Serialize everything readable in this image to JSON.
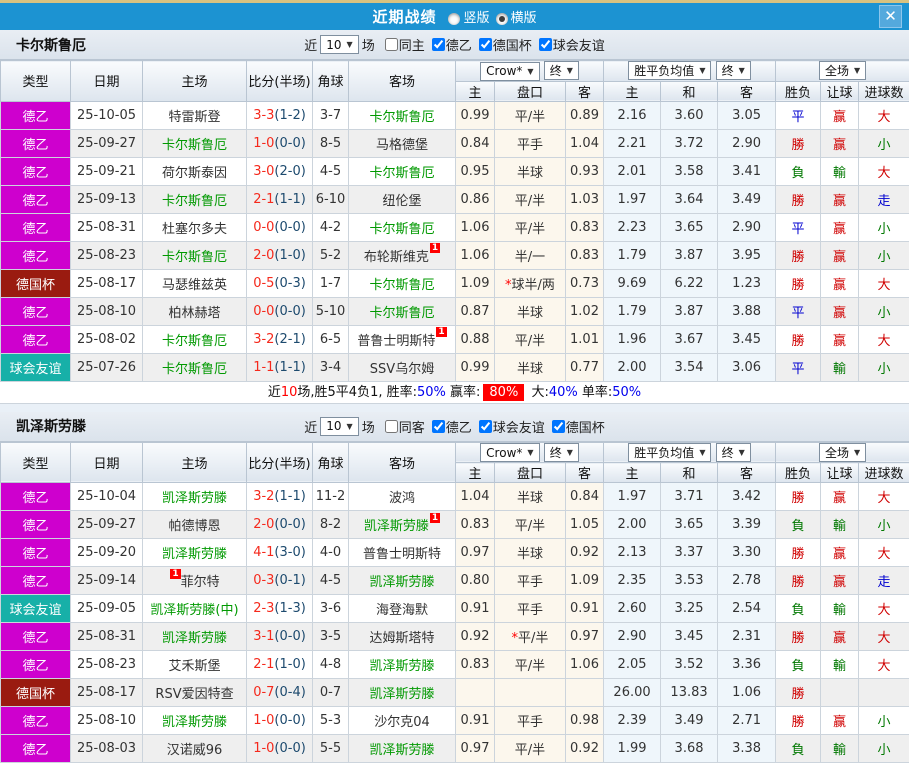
{
  "titlebar": {
    "title": "近期战绩",
    "radios": [
      {
        "label": "竖版",
        "selected": false
      },
      {
        "label": "横版",
        "selected": true
      }
    ],
    "close": "✕"
  },
  "table_header": {
    "main": [
      "类型",
      "日期",
      "主场",
      "比分(半场)",
      "角球",
      "客场"
    ],
    "groups": {
      "odds": [
        "Crow*",
        "终"
      ],
      "mean": [
        "胜平负均值",
        "终"
      ],
      "full": [
        "全场"
      ]
    },
    "sub": [
      "主",
      "盘口",
      "客",
      "主",
      "和",
      "客",
      "胜负",
      "让球",
      "进球数"
    ]
  },
  "type_colors": {
    "德乙": "#ce00ce",
    "德国杯": "#9a1b10",
    "球会友谊": "#17b0a8"
  },
  "colors": {
    "titlebar_blue": "#1c93d2",
    "team_green": "#009900",
    "score_red": "#f5291c",
    "result_red": "#d00000",
    "result_blue": "#0000d0",
    "result_green": "#007800"
  },
  "tables": [
    {
      "team": "卡尔斯鲁厄",
      "filters": {
        "near": "近",
        "count": "10",
        "unit": "场",
        "checkboxes": [
          {
            "label": "同主",
            "checked": false
          },
          {
            "label": "德乙",
            "checked": true
          },
          {
            "label": "德国杯",
            "checked": true
          },
          {
            "label": "球会友谊",
            "checked": true
          }
        ]
      },
      "rows": [
        {
          "type": "德乙",
          "date": "25-10-05",
          "home": {
            "name": "特雷斯登"
          },
          "score": {
            "full": "3-3",
            "half": "(1-2)"
          },
          "corner": "3-7",
          "away": {
            "name": "卡尔斯鲁厄",
            "green": true
          },
          "odds": {
            "home": "0.99",
            "handicap": "平/半",
            "away": "0.89"
          },
          "mean": {
            "home": "2.16",
            "draw": "3.60",
            "away": "3.05"
          },
          "results": [
            "平",
            "赢",
            "大"
          ]
        },
        {
          "type": "德乙",
          "date": "25-09-27",
          "home": {
            "name": "卡尔斯鲁厄",
            "green": true
          },
          "score": {
            "full": "1-0",
            "half": "(0-0)"
          },
          "corner": "8-5",
          "away": {
            "name": "马格德堡"
          },
          "odds": {
            "home": "0.84",
            "handicap": "平手",
            "away": "1.04"
          },
          "mean": {
            "home": "2.21",
            "draw": "3.72",
            "away": "2.90"
          },
          "results": [
            "勝",
            "赢",
            "小"
          ]
        },
        {
          "type": "德乙",
          "date": "25-09-21",
          "home": {
            "name": "荷尔斯泰因"
          },
          "score": {
            "full": "3-0",
            "half": "(2-0)"
          },
          "corner": "4-5",
          "away": {
            "name": "卡尔斯鲁厄",
            "green": true
          },
          "odds": {
            "home": "0.95",
            "handicap": "半球",
            "away": "0.93"
          },
          "mean": {
            "home": "2.01",
            "draw": "3.58",
            "away": "3.41"
          },
          "results": [
            "負",
            "輸",
            "大"
          ]
        },
        {
          "type": "德乙",
          "date": "25-09-13",
          "home": {
            "name": "卡尔斯鲁厄",
            "green": true
          },
          "score": {
            "full": "2-1",
            "half": "(1-1)"
          },
          "corner": "6-10",
          "away": {
            "name": "纽伦堡"
          },
          "odds": {
            "home": "0.86",
            "handicap": "平/半",
            "away": "1.03"
          },
          "mean": {
            "home": "1.97",
            "draw": "3.64",
            "away": "3.49"
          },
          "results": [
            "勝",
            "赢",
            "走"
          ]
        },
        {
          "type": "德乙",
          "date": "25-08-31",
          "home": {
            "name": "杜塞尔多夫"
          },
          "score": {
            "full": "0-0",
            "half": "(0-0)"
          },
          "corner": "4-2",
          "away": {
            "name": "卡尔斯鲁厄",
            "green": true
          },
          "odds": {
            "home": "1.06",
            "handicap": "平/半",
            "away": "0.83"
          },
          "mean": {
            "home": "2.23",
            "draw": "3.65",
            "away": "2.90"
          },
          "results": [
            "平",
            "赢",
            "小"
          ]
        },
        {
          "type": "德乙",
          "date": "25-08-23",
          "home": {
            "name": "卡尔斯鲁厄",
            "green": true
          },
          "score": {
            "full": "2-0",
            "half": "(1-0)"
          },
          "corner": "5-2",
          "away": {
            "name": "布轮斯维克",
            "card": "after"
          },
          "odds": {
            "home": "1.06",
            "handicap": "半/一",
            "away": "0.83"
          },
          "mean": {
            "home": "1.79",
            "draw": "3.87",
            "away": "3.95"
          },
          "results": [
            "勝",
            "赢",
            "小"
          ]
        },
        {
          "type": "德国杯",
          "date": "25-08-17",
          "home": {
            "name": "马瑟维兹英"
          },
          "score": {
            "full": "0-5",
            "half": "(0-3)"
          },
          "corner": "1-7",
          "away": {
            "name": "卡尔斯鲁厄",
            "green": true
          },
          "odds": {
            "home": "1.09",
            "handicap": "球半/两",
            "star": true,
            "away": "0.73"
          },
          "mean": {
            "home": "9.69",
            "draw": "6.22",
            "away": "1.23"
          },
          "results": [
            "勝",
            "赢",
            "大"
          ]
        },
        {
          "type": "德乙",
          "date": "25-08-10",
          "home": {
            "name": "柏林赫塔"
          },
          "score": {
            "full": "0-0",
            "half": "(0-0)"
          },
          "corner": "5-10",
          "away": {
            "name": "卡尔斯鲁厄",
            "green": true
          },
          "odds": {
            "home": "0.87",
            "handicap": "半球",
            "away": "1.02"
          },
          "mean": {
            "home": "1.79",
            "draw": "3.87",
            "away": "3.88"
          },
          "results": [
            "平",
            "赢",
            "小"
          ]
        },
        {
          "type": "德乙",
          "date": "25-08-02",
          "home": {
            "name": "卡尔斯鲁厄",
            "green": true
          },
          "score": {
            "full": "3-2",
            "half": "(2-1)"
          },
          "corner": "6-5",
          "away": {
            "name": "普鲁士明斯特",
            "card": "after"
          },
          "odds": {
            "home": "0.88",
            "handicap": "平/半",
            "away": "1.01"
          },
          "mean": {
            "home": "1.96",
            "draw": "3.67",
            "away": "3.45"
          },
          "results": [
            "勝",
            "赢",
            "大"
          ]
        },
        {
          "type": "球会友谊",
          "date": "25-07-26",
          "home": {
            "name": "卡尔斯鲁厄",
            "green": true
          },
          "score": {
            "full": "1-1",
            "half": "(1-1)"
          },
          "corner": "3-4",
          "away": {
            "name": "SSV乌尔姆"
          },
          "odds": {
            "home": "0.99",
            "handicap": "半球",
            "away": "0.77"
          },
          "mean": {
            "home": "2.00",
            "draw": "3.54",
            "away": "3.06"
          },
          "results": [
            "平",
            "輸",
            "小"
          ]
        }
      ],
      "summary": [
        {
          "t": "近"
        },
        {
          "t": "10",
          "c": "red"
        },
        {
          "t": "场,胜5平4负1, 胜率:"
        },
        {
          "t": "50%",
          "c": "blue"
        },
        {
          "t": " 赢率:"
        },
        {
          "t": "80%",
          "c": "redbox"
        },
        {
          "t": " 大:"
        },
        {
          "t": "40%",
          "c": "blue"
        },
        {
          "t": " 单率:"
        },
        {
          "t": "50%",
          "c": "blue"
        }
      ]
    },
    {
      "team": "凯泽斯劳滕",
      "filters": {
        "near": "近",
        "count": "10",
        "unit": "场",
        "checkboxes": [
          {
            "label": "同客",
            "checked": false
          },
          {
            "label": "德乙",
            "checked": true
          },
          {
            "label": "球会友谊",
            "checked": true
          },
          {
            "label": "德国杯",
            "checked": true
          }
        ]
      },
      "rows": [
        {
          "type": "德乙",
          "date": "25-10-04",
          "home": {
            "name": "凯泽斯劳滕",
            "green": true
          },
          "score": {
            "full": "3-2",
            "half": "(1-1)"
          },
          "corner": "11-2",
          "away": {
            "name": "波鸿"
          },
          "odds": {
            "home": "1.04",
            "handicap": "半球",
            "away": "0.84"
          },
          "mean": {
            "home": "1.97",
            "draw": "3.71",
            "away": "3.42"
          },
          "results": [
            "勝",
            "赢",
            "大"
          ]
        },
        {
          "type": "德乙",
          "date": "25-09-27",
          "home": {
            "name": "帕德博恩"
          },
          "score": {
            "full": "2-0",
            "half": "(0-0)"
          },
          "corner": "8-2",
          "away": {
            "name": "凯泽斯劳滕",
            "green": true,
            "card": "after"
          },
          "odds": {
            "home": "0.83",
            "handicap": "平/半",
            "away": "1.05"
          },
          "mean": {
            "home": "2.00",
            "draw": "3.65",
            "away": "3.39"
          },
          "results": [
            "負",
            "輸",
            "小"
          ]
        },
        {
          "type": "德乙",
          "date": "25-09-20",
          "home": {
            "name": "凯泽斯劳滕",
            "green": true
          },
          "score": {
            "full": "4-1",
            "half": "(3-0)"
          },
          "corner": "4-0",
          "away": {
            "name": "普鲁士明斯特"
          },
          "odds": {
            "home": "0.97",
            "handicap": "半球",
            "away": "0.92"
          },
          "mean": {
            "home": "2.13",
            "draw": "3.37",
            "away": "3.30"
          },
          "results": [
            "勝",
            "赢",
            "大"
          ]
        },
        {
          "type": "德乙",
          "date": "25-09-14",
          "home": {
            "name": "菲尔特",
            "card": "before"
          },
          "score": {
            "full": "0-3",
            "half": "(0-1)"
          },
          "corner": "4-5",
          "away": {
            "name": "凯泽斯劳滕",
            "green": true
          },
          "odds": {
            "home": "0.80",
            "handicap": "平手",
            "away": "1.09"
          },
          "mean": {
            "home": "2.35",
            "draw": "3.53",
            "away": "2.78"
          },
          "results": [
            "勝",
            "赢",
            "走"
          ]
        },
        {
          "type": "球会友谊",
          "date": "25-09-05",
          "home": {
            "name": "凯泽斯劳滕(中)",
            "green": true
          },
          "score": {
            "full": "2-3",
            "half": "(1-3)"
          },
          "corner": "3-6",
          "away": {
            "name": "海登海默"
          },
          "odds": {
            "home": "0.91",
            "handicap": "平手",
            "away": "0.91"
          },
          "mean": {
            "home": "2.60",
            "draw": "3.25",
            "away": "2.54"
          },
          "results": [
            "負",
            "輸",
            "大"
          ]
        },
        {
          "type": "德乙",
          "date": "25-08-31",
          "home": {
            "name": "凯泽斯劳滕",
            "green": true
          },
          "score": {
            "full": "3-1",
            "half": "(0-0)"
          },
          "corner": "3-5",
          "away": {
            "name": "达姆斯塔特"
          },
          "odds": {
            "home": "0.92",
            "handicap": "平/半",
            "star": true,
            "away": "0.97"
          },
          "mean": {
            "home": "2.90",
            "draw": "3.45",
            "away": "2.31"
          },
          "results": [
            "勝",
            "赢",
            "大"
          ]
        },
        {
          "type": "德乙",
          "date": "25-08-23",
          "home": {
            "name": "艾禾斯堡"
          },
          "score": {
            "full": "2-1",
            "half": "(1-0)"
          },
          "corner": "4-8",
          "away": {
            "name": "凯泽斯劳滕",
            "green": true
          },
          "odds": {
            "home": "0.83",
            "handicap": "平/半",
            "away": "1.06"
          },
          "mean": {
            "home": "2.05",
            "draw": "3.52",
            "away": "3.36"
          },
          "results": [
            "負",
            "輸",
            "大"
          ]
        },
        {
          "type": "德国杯",
          "date": "25-08-17",
          "home": {
            "name": "RSV爱因特查"
          },
          "score": {
            "full": "0-7",
            "half": "(0-4)"
          },
          "corner": "0-7",
          "away": {
            "name": "凯泽斯劳滕",
            "green": true
          },
          "odds": {
            "home": "",
            "handicap": "",
            "away": ""
          },
          "mean": {
            "home": "26.00",
            "draw": "13.83",
            "away": "1.06"
          },
          "results": [
            "勝",
            "",
            ""
          ]
        },
        {
          "type": "德乙",
          "date": "25-08-10",
          "home": {
            "name": "凯泽斯劳滕",
            "green": true
          },
          "score": {
            "full": "1-0",
            "half": "(0-0)"
          },
          "corner": "5-3",
          "away": {
            "name": "沙尔克04"
          },
          "odds": {
            "home": "0.91",
            "handicap": "平手",
            "away": "0.98"
          },
          "mean": {
            "home": "2.39",
            "draw": "3.49",
            "away": "2.71"
          },
          "results": [
            "勝",
            "赢",
            "小"
          ]
        },
        {
          "type": "德乙",
          "date": "25-08-03",
          "home": {
            "name": "汉诺威96"
          },
          "score": {
            "full": "1-0",
            "half": "(0-0)"
          },
          "corner": "5-5",
          "away": {
            "name": "凯泽斯劳滕",
            "green": true
          },
          "odds": {
            "home": "0.97",
            "handicap": "平/半",
            "away": "0.92"
          },
          "mean": {
            "home": "1.99",
            "draw": "3.68",
            "away": "3.38"
          },
          "results": [
            "負",
            "輸",
            "小"
          ]
        }
      ]
    }
  ]
}
